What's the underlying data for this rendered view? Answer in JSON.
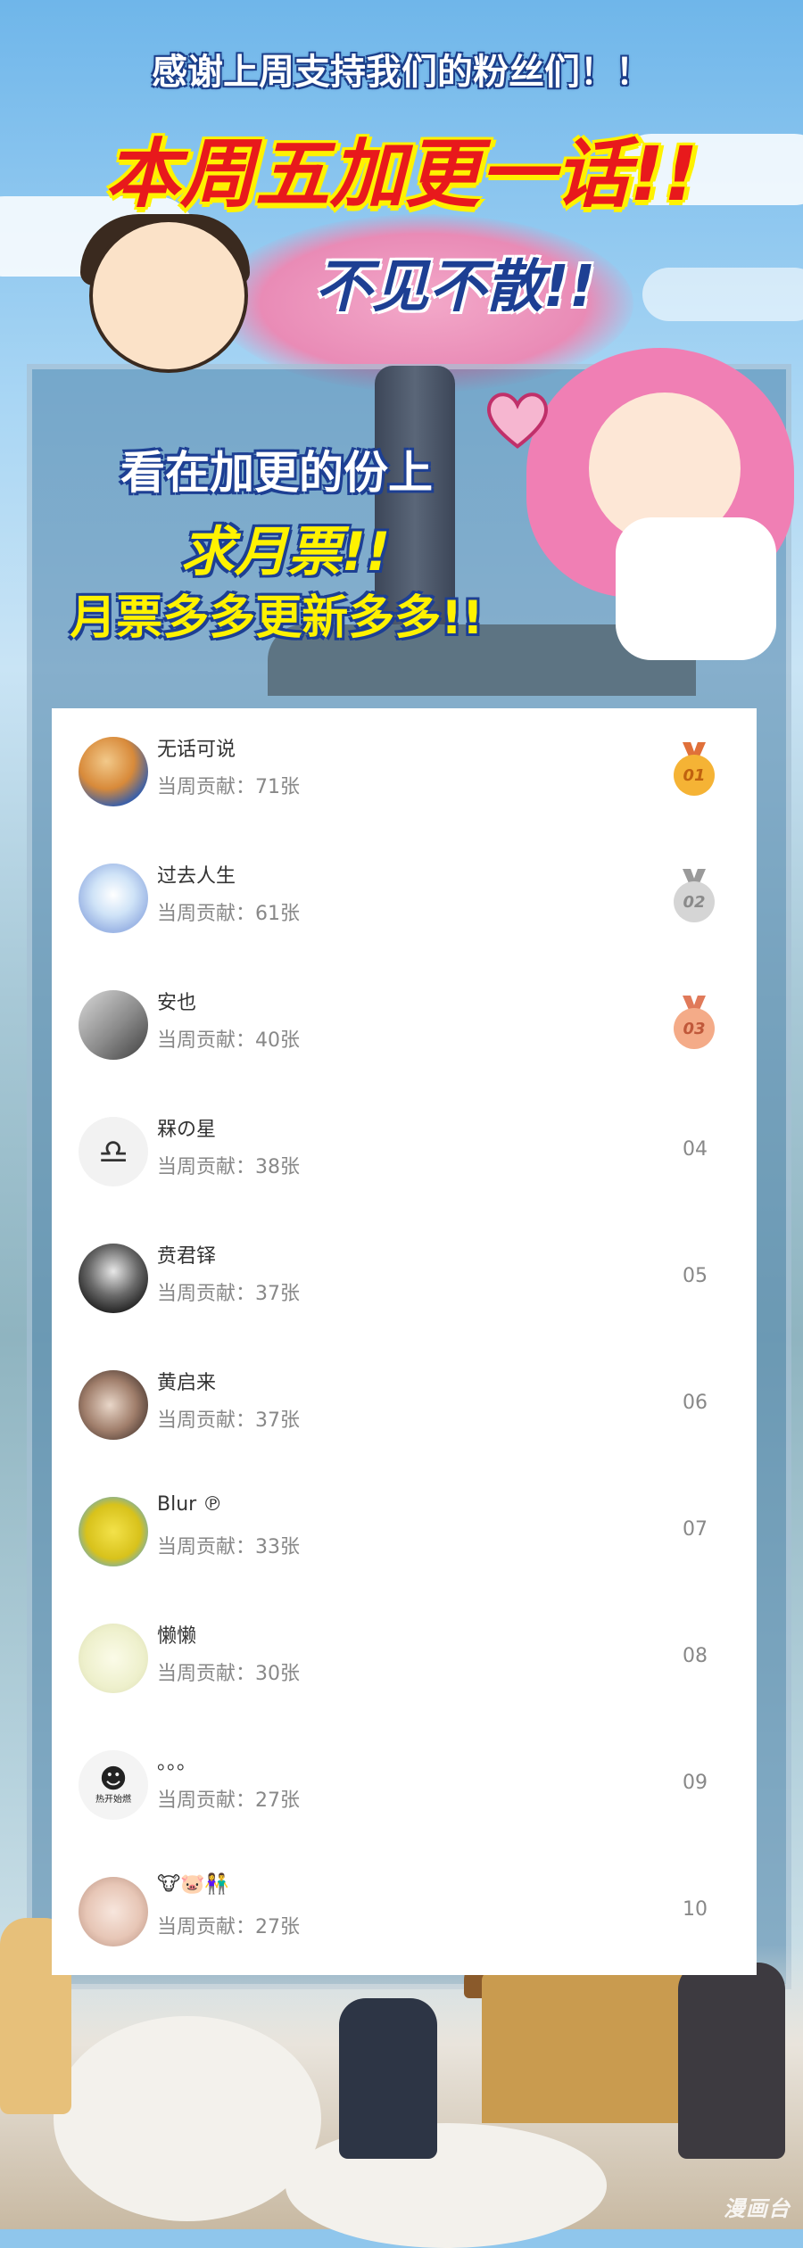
{
  "banner": {
    "thanks": "感谢上周支持我们的粉丝们！！",
    "headline": "本周五加更一话!!",
    "see_you": "不见不散!!",
    "plea_line1": "看在加更的份上",
    "plea_line2": "求月票!!",
    "plea_line3": "月票多多更新多多!!"
  },
  "ranking": {
    "rows": [
      {
        "name": "无话可说",
        "contribution": "当周贡献：71张",
        "rank": "01",
        "medal": "gold"
      },
      {
        "name": "过去人生",
        "contribution": "当周贡献：61张",
        "rank": "02",
        "medal": "silver"
      },
      {
        "name": "安也",
        "contribution": "当周贡献：40张",
        "rank": "03",
        "medal": "bronze"
      },
      {
        "name": "槑の星",
        "contribution": "当周贡献：38张",
        "rank": "04"
      },
      {
        "name": "贲君铎",
        "contribution": "当周贡献：37张",
        "rank": "05"
      },
      {
        "name": "黄启来",
        "contribution": "当周贡献：37张",
        "rank": "06"
      },
      {
        "name": "Blur ℗",
        "contribution": "当周贡献：33张",
        "rank": "07"
      },
      {
        "name": "懒懒",
        "contribution": "当周贡献：30张",
        "rank": "08"
      },
      {
        "name": "。。。",
        "contribution": "当周贡献：27张",
        "rank": "09"
      },
      {
        "name": "🐮🐷👫",
        "contribution": "当周贡献：27张",
        "rank": "10"
      }
    ]
  },
  "colors": {
    "gold": "#f5b335",
    "silver": "#c8c8c8",
    "bronze": "#f0a07a",
    "headline_red": "#e8191c",
    "headline_yellow": "#fff200",
    "outline_blue": "#1d3f93"
  },
  "avatar_text": {
    "row9_caption": "热开始燃"
  },
  "watermark": "漫画台"
}
